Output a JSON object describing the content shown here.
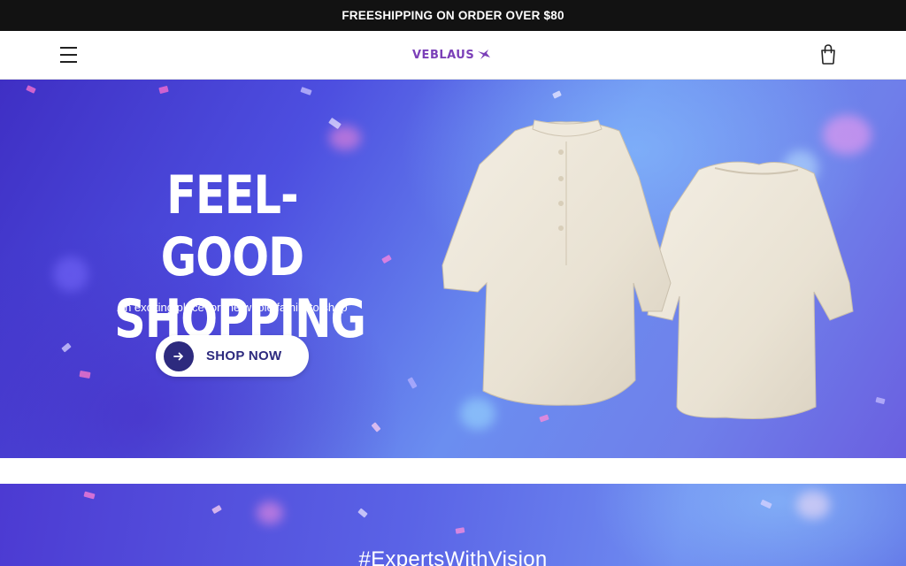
{
  "announcement": {
    "text": "FREESHIPPING ON ORDER OVER $80"
  },
  "header": {
    "logo_text": "VEBLAUS",
    "menu_icon": "hamburger-menu-icon",
    "cart_icon": "shopping-bag-icon"
  },
  "hero": {
    "title_line1": "FEEL-GOOD",
    "title_line2": "SHOPPING",
    "subtitle": "An exciting place for the whole family to shop",
    "cta_label": "SHOP NOW",
    "cta_icon": "arrow-right-icon",
    "image_subject": "cream linen shirts front and back"
  },
  "promo": {
    "title": "#ExpertsWithVision"
  },
  "colors": {
    "announcement_bg": "#121212",
    "brand_purple": "#7b3fb8",
    "cta_text": "#2d2a7e",
    "hero_blue": "#4d4fe0"
  }
}
